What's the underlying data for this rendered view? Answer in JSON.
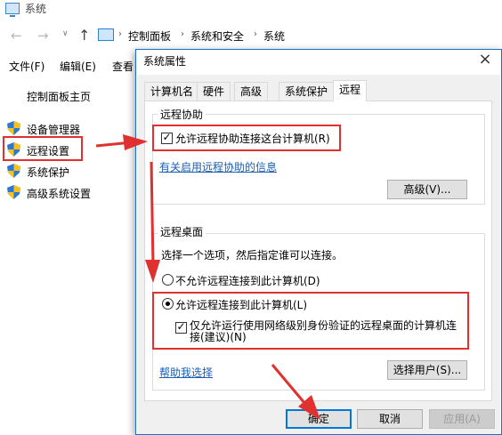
{
  "window": {
    "title": "系统"
  },
  "address_bar": {
    "crumbs": [
      "控制面板",
      "系统和安全",
      "系统"
    ]
  },
  "menubar": {
    "items": [
      "文件(F)",
      "编辑(E)",
      "查看"
    ]
  },
  "sidebar": {
    "home": "控制面板主页",
    "items": [
      {
        "label": "设备管理器",
        "icon": "shield-icon"
      },
      {
        "label": "远程设置",
        "icon": "shield-icon"
      },
      {
        "label": "系统保护",
        "icon": "shield-icon"
      },
      {
        "label": "高级系统设置",
        "icon": "shield-icon"
      }
    ]
  },
  "dialog": {
    "title": "系统属性",
    "tabs": [
      "计算机名",
      "硬件",
      "高级",
      "系统保护",
      "远程"
    ],
    "active_tab": "远程",
    "remote_assistance": {
      "group_title": "远程协助",
      "checkbox_label": "允许远程协助连接这台计算机(R)",
      "checked": true,
      "link": "有关启用远程协助的信息",
      "advanced_button": "高级(V)..."
    },
    "remote_desktop": {
      "group_title": "远程桌面",
      "instruction": "选择一个选项，然后指定谁可以连接。",
      "option_deny": "不允许远程连接到此计算机(D)",
      "option_allow": "允许远程连接到此计算机(L)",
      "selected": "allow",
      "nla_line1": "仅允许运行使用网络级别身份验证的远程桌面的计算机连",
      "nla_line2": "接(建议)(N)",
      "nla_checked": true,
      "help_link": "帮助我选择",
      "select_users_button": "选择用户(S)..."
    },
    "buttons": {
      "ok": "确定",
      "cancel": "取消",
      "apply": "应用(A)"
    }
  },
  "colors": {
    "highlight": "#e03030",
    "link": "#1a5fb4",
    "accent": "#0078d7"
  }
}
